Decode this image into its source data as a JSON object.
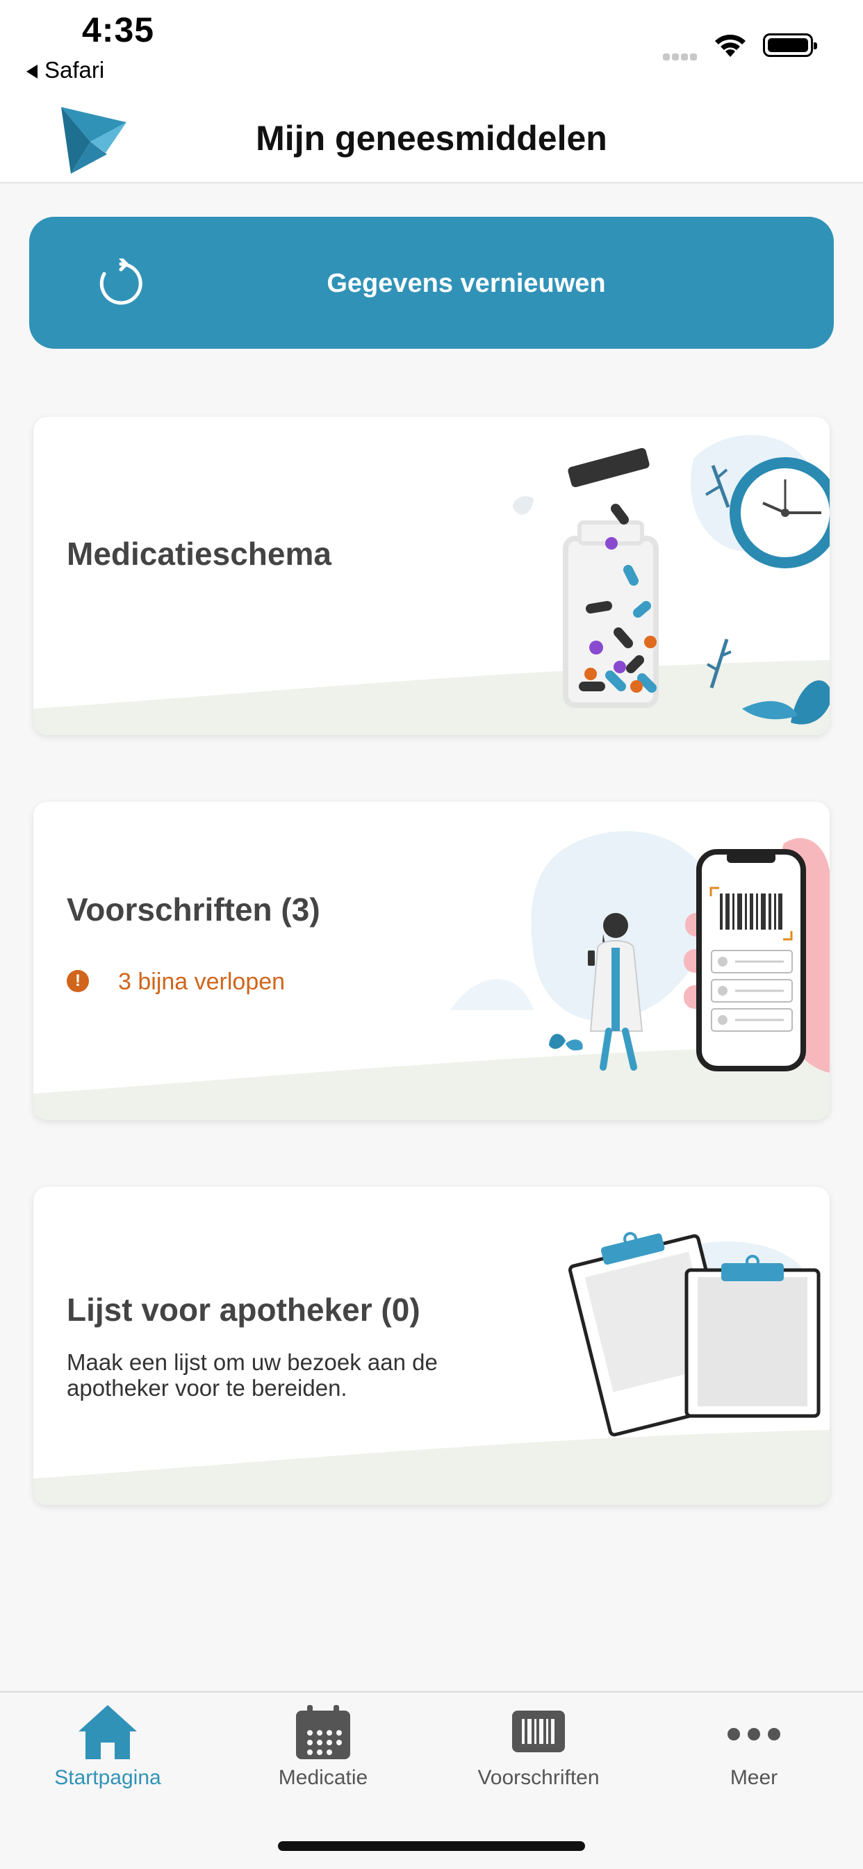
{
  "status_bar": {
    "time": "4:35",
    "back_app": "Safari"
  },
  "header": {
    "title": "Mijn geneesmiddelen"
  },
  "refresh_button": {
    "label": "Gegevens vernieuwen"
  },
  "cards": [
    {
      "title": "Medicatieschema"
    },
    {
      "title": "Voorschriften (3)",
      "warning": "3 bijna verlopen",
      "warning_icon": "!"
    },
    {
      "title": "Lijst voor apotheker (0)",
      "description": "Maak een lijst om uw bezoek aan de apotheker voor te bereiden."
    }
  ],
  "tabs": [
    {
      "label": "Startpagina",
      "icon": "home-icon",
      "active": true
    },
    {
      "label": "Medicatie",
      "icon": "calendar-icon",
      "active": false
    },
    {
      "label": "Voorschriften",
      "icon": "barcode-icon",
      "active": false
    },
    {
      "label": "Meer",
      "icon": "more-icon",
      "active": false
    }
  ],
  "colors": {
    "accent": "#3192b8",
    "warning": "#d0651b",
    "background": "#f7f7f7",
    "tab_inactive": "#555555"
  }
}
